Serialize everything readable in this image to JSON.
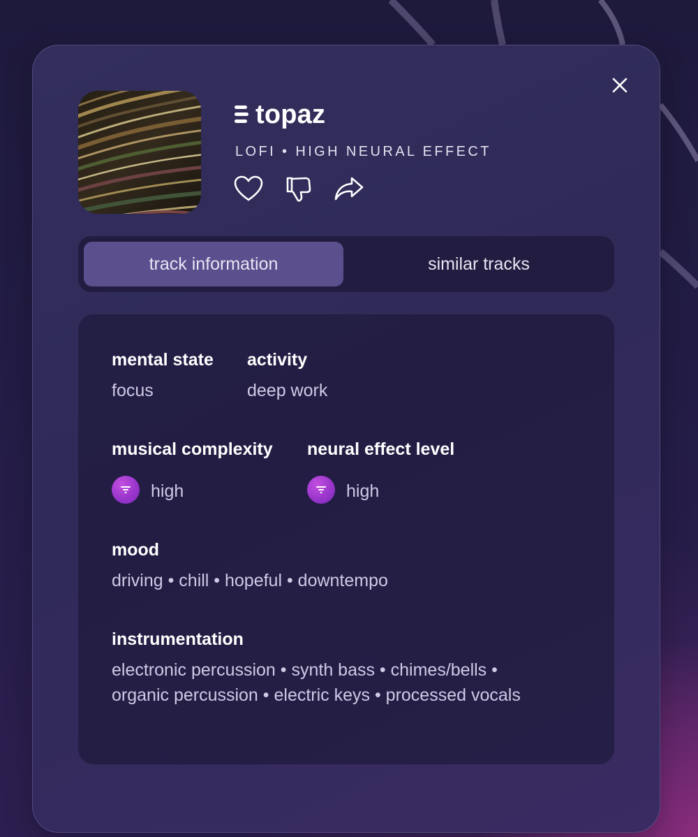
{
  "track": {
    "title": "topaz",
    "subtitle": "LOFI • HIGH NEURAL EFFECT"
  },
  "icons": {
    "close": "close-icon",
    "title_badge": "menu-lines-icon",
    "like": "heart-icon",
    "dislike": "thumbs-down-icon",
    "share": "share-arrow-icon",
    "level": "filter-icon"
  },
  "tabs": {
    "track_information": "track information",
    "similar_tracks": "similar tracks",
    "active": "track information"
  },
  "info": {
    "mental_state": {
      "label": "mental state",
      "value": "focus"
    },
    "activity": {
      "label": "activity",
      "value": "deep work"
    },
    "musical_complexity": {
      "label": "musical complexity",
      "value": "high"
    },
    "neural_effect_level": {
      "label": "neural effect level",
      "value": "high"
    },
    "mood": {
      "label": "mood",
      "value": "driving • chill • hopeful • downtempo"
    },
    "instrumentation": {
      "label": "instrumentation",
      "line1": "electronic percussion • synth bass • chimes/bells •",
      "line2": "organic percussion • electric keys • processed vocals"
    }
  },
  "colors": {
    "background": "#1e1a3c",
    "card": "#332e5c",
    "active_tab": "#5b4f8e",
    "level_icon": "#9a36cc",
    "accent_magenta": "#8a2c7c"
  }
}
